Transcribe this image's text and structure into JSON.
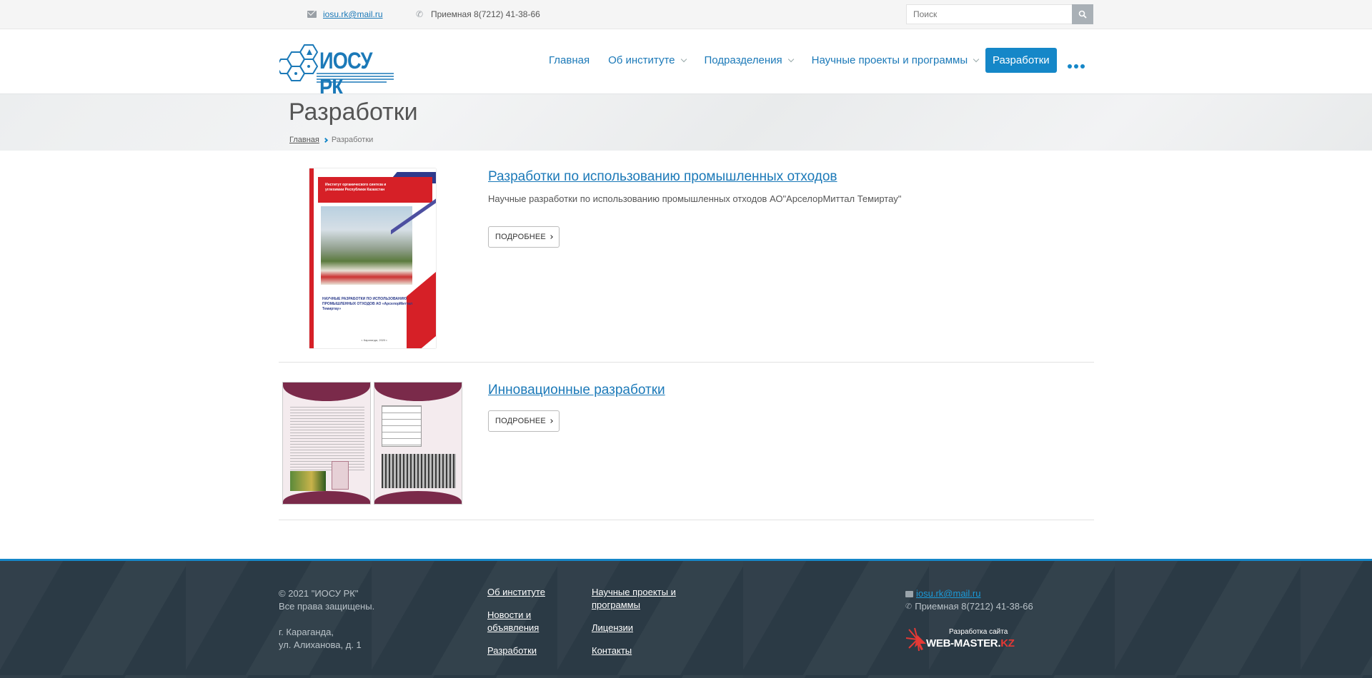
{
  "topbar": {
    "email": "iosu.rk@mail.ru",
    "phone": "Приемная 8(7212) 41-38-66",
    "search_placeholder": "Поиск"
  },
  "logo": {
    "text": "ИОСУ РК"
  },
  "nav": {
    "items": [
      {
        "label": "Главная",
        "dropdown": false
      },
      {
        "label": "Об институте",
        "dropdown": true
      },
      {
        "label": "Подразделения",
        "dropdown": true
      },
      {
        "label": "Научные проекты и программы",
        "dropdown": true
      }
    ],
    "active": "Разработки"
  },
  "page": {
    "title": "Разработки",
    "breadcrumb": {
      "home": "Главная",
      "current": "Разработки"
    }
  },
  "items": [
    {
      "title": "Разработки по использованию промышленных отходов",
      "description": "Научные разработки по использованию промышленных отходов АО\"АрселорМиттал Темиртау\"",
      "button": "ПОДРОБНЕЕ",
      "cover": {
        "header": "Институт органического синтеза и углехимии Республики Казахстан",
        "subtitle": "НАУЧНЫЕ РАЗРАБОТКИ ПО ИСПОЛЬЗОВАНИЮ ПРОМЫШЛЕННЫХ ОТХОДОВ АО «АрселорМиттал Темиртау»",
        "footer": "г. Караганда, 2020 г."
      }
    },
    {
      "title": "Инновационные разработки",
      "description": "",
      "button": "ПОДРОБНЕЕ"
    }
  ],
  "footer": {
    "copyright": "© 2021 \"ИОСУ РК\"",
    "rights": "Все права защищены.",
    "city": "г. Караганда,",
    "street": "ул. Алиханова, д. 1",
    "links_col1": [
      "Об институте",
      "Новости и объявления",
      "Разработки"
    ],
    "links_col2": [
      "Научные проекты и программы",
      "Лицензии",
      "Контакты"
    ],
    "email": "iosu.rk@mail.ru",
    "phone": "Приемная 8(7212) 41-38-66",
    "dev_label": "Разработка сайта",
    "dev_brand": "WEB-MASTER.",
    "dev_brand_suffix": "KZ"
  },
  "colors": {
    "accent": "#1587c8",
    "link": "#1b79b8",
    "footer_bg": "#2b3a45",
    "brand_red": "#d62027"
  }
}
